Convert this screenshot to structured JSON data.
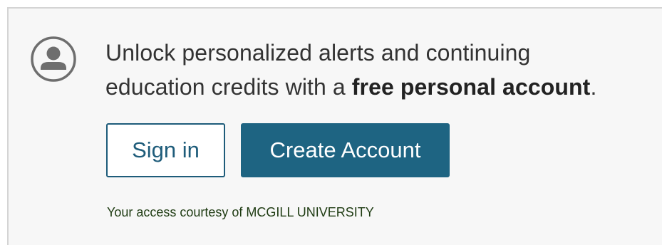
{
  "promo": {
    "message_line1": "Unlock personalized alerts and continuing",
    "message_line2_prefix": "education credits with a ",
    "message_bold": "free personal account",
    "message_suffix": "."
  },
  "buttons": {
    "sign_in_label": "Sign in",
    "create_account_label": "Create Account"
  },
  "access": {
    "courtesy_text": "Your access courtesy of MCGILL UNIVERSITY"
  },
  "colors": {
    "accent": "#1e6482",
    "highlight": "#6be31c",
    "panel_background": "#f7f7f7"
  },
  "icons": {
    "avatar": "user-circle-icon"
  }
}
